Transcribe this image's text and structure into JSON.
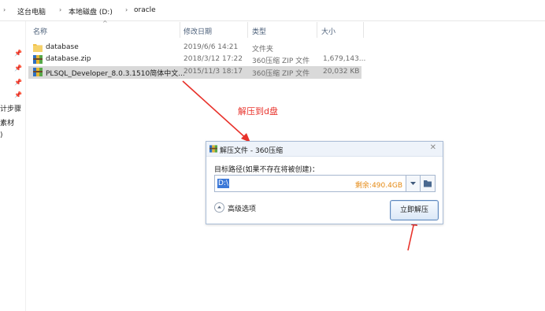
{
  "breadcrumb": [
    "这台电脑",
    "本地磁盘 (D:)",
    "oracle"
  ],
  "nav": {
    "items": [
      "计步骤",
      "素材",
      ")"
    ]
  },
  "columns": {
    "name": "名称",
    "date": "修改日期",
    "type": "类型",
    "size": "大小"
  },
  "files": [
    {
      "icon": "folder-icon",
      "name": "database",
      "date": "2019/6/6 14:21",
      "type": "文件夹",
      "size": ""
    },
    {
      "icon": "archive-icon",
      "name": "database.zip",
      "date": "2018/3/12 17:22",
      "type": "360压缩 ZIP 文件",
      "size": "1,679,143..."
    },
    {
      "icon": "archive-icon",
      "name": "PLSQL_Developer_8.0.3.1510简体中文...",
      "date": "2015/11/3 18:17",
      "type": "360压缩 ZIP 文件",
      "size": "20,032 KB",
      "selected": true
    }
  ],
  "annotation": "解压到d盘",
  "dialog": {
    "title": "解压文件 - 360压缩",
    "path_label": "目标路径(如果不存在将被创建)：",
    "path_value": "D:\\",
    "free_space": "剩余:490.4GB",
    "advanced_label": "高级选项",
    "ok_label": "立即解压"
  },
  "colors": {
    "accent": "#3b78d8",
    "annotation": "#e8322b",
    "free_space": "#e58a14",
    "dialog_border": "#a9bcd6"
  }
}
